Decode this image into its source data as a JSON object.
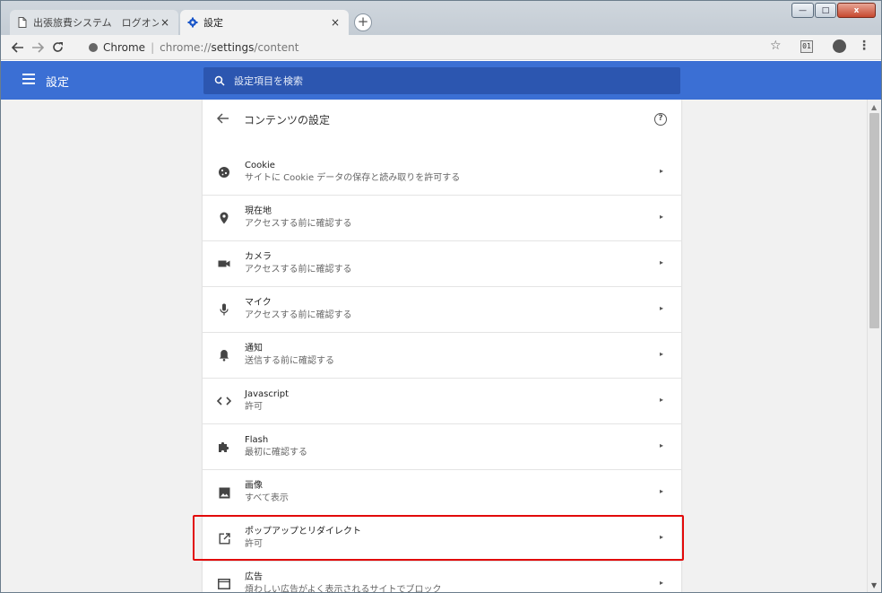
{
  "tabs": [
    {
      "title": "出張旅費システム　ログオン",
      "icon": "document-icon",
      "close": "×"
    },
    {
      "title": "設定",
      "icon": "gear-icon",
      "close": "×"
    }
  ],
  "new_tab_label": "+",
  "window_controls": {
    "minimize": "—",
    "maximize": "□",
    "close": "x"
  },
  "address_bar": {
    "site_label": "Chrome",
    "separator": "|",
    "url_scheme": "chrome://",
    "url_host": "settings",
    "url_path": "/content"
  },
  "extension_badge": "01",
  "header": {
    "title": "設定",
    "search_placeholder": "設定項目を検索"
  },
  "subpage": {
    "title": "コンテンツの設定",
    "help_symbol": "?"
  },
  "settings": [
    {
      "id": "cookie",
      "label": "Cookie",
      "sub": "サイトに Cookie データの保存と読み取りを許可する",
      "icon": "cookie-icon"
    },
    {
      "id": "location",
      "label": "現在地",
      "sub": "アクセスする前に確認する",
      "icon": "location-pin-icon"
    },
    {
      "id": "camera",
      "label": "カメラ",
      "sub": "アクセスする前に確認する",
      "icon": "camera-icon"
    },
    {
      "id": "microphone",
      "label": "マイク",
      "sub": "アクセスする前に確認する",
      "icon": "microphone-icon"
    },
    {
      "id": "notifications",
      "label": "通知",
      "sub": "送信する前に確認する",
      "icon": "bell-icon"
    },
    {
      "id": "javascript",
      "label": "Javascript",
      "sub": "許可",
      "icon": "code-icon"
    },
    {
      "id": "flash",
      "label": "Flash",
      "sub": "最初に確認する",
      "icon": "puzzle-icon"
    },
    {
      "id": "images",
      "label": "画像",
      "sub": "すべて表示",
      "icon": "image-icon"
    },
    {
      "id": "popups",
      "label": "ポップアップとリダイレクト",
      "sub": "許可",
      "icon": "open-in-new-icon"
    },
    {
      "id": "ads",
      "label": "広告",
      "sub": "煩わしい広告がよく表示されるサイトでブロック",
      "icon": "ads-icon"
    }
  ],
  "row_arrow": "▸",
  "colors": {
    "header_blue": "#3b6fd4",
    "search_blue": "#2c56b0",
    "highlight_red": "#e20a0a"
  }
}
